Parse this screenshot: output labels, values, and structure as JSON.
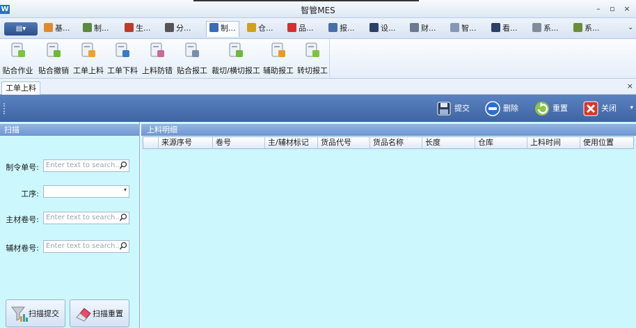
{
  "window": {
    "title": "智管MES",
    "app_icon": "W",
    "minimize": "–",
    "maximize": "▫",
    "close": "×"
  },
  "menu": {
    "app_button": "▤▾",
    "tabs": [
      {
        "label": "基...",
        "icon": "basic-data-icon",
        "color": "#e28a2b"
      },
      {
        "label": "制...",
        "icon": "chart-icon",
        "color": "#5a8a3a"
      },
      {
        "label": "生...",
        "icon": "production-icon",
        "color": "#c0392b"
      },
      {
        "label": "分...",
        "icon": "scissors-icon",
        "color": "#555555"
      },
      {
        "label": "制...",
        "icon": "magnifier-icon",
        "color": "#3b6cb7"
      },
      {
        "label": "仓...",
        "icon": "warehouse-icon",
        "color": "#d4a017"
      },
      {
        "label": "品...",
        "icon": "diamond-icon",
        "color": "#d63031"
      },
      {
        "label": "报...",
        "icon": "report-icon",
        "color": "#4a6fa5"
      },
      {
        "label": "设...",
        "icon": "device-icon",
        "color": "#2d3f66"
      },
      {
        "label": "财...",
        "icon": "finance-icon",
        "color": "#6b7a8f"
      },
      {
        "label": "智...",
        "icon": "smart-icon",
        "color": "#8597b5"
      },
      {
        "label": "看...",
        "icon": "board-icon",
        "color": "#2d3f66"
      },
      {
        "label": "系...",
        "icon": "gear-icon",
        "color": "#7f8c9b"
      },
      {
        "label": "系...",
        "icon": "system-icon",
        "color": "#6a8f3a"
      }
    ],
    "more": "⌄",
    "active_tab_index": 4
  },
  "ribbon": {
    "buttons": [
      {
        "label": "贴合作业",
        "icon": "laminate-work-icon"
      },
      {
        "label": "贴合撤销",
        "icon": "laminate-undo-icon"
      },
      {
        "label": "工单上料",
        "icon": "order-feed-icon"
      },
      {
        "label": "工单下料",
        "icon": "order-unload-icon"
      },
      {
        "label": "上料防错",
        "icon": "feed-errorproof-icon"
      },
      {
        "label": "贴合报工",
        "icon": "laminate-report-icon"
      },
      {
        "label": "裁切/横切报工",
        "icon": "cut-report-icon"
      },
      {
        "label": "辅助报工",
        "icon": "aux-report-icon"
      },
      {
        "label": "转切报工",
        "icon": "rotary-report-icon"
      }
    ]
  },
  "doc_tab": {
    "label": "工单上料",
    "close": "×"
  },
  "toolbar": {
    "submit": "提交",
    "delete": "删除",
    "reset": "重置",
    "close": "关闭",
    "more": "▾"
  },
  "scan_panel": {
    "title": "扫描",
    "fields": {
      "order_no_label": "制令单号:",
      "order_no_placeholder": "Enter text to search...",
      "process_label": "工序:",
      "process_value": "",
      "main_roll_label": "主材卷号:",
      "main_roll_placeholder": "Enter text to search...",
      "aux_roll_label": "辅材卷号:",
      "aux_roll_placeholder": "Enter text to search..."
    },
    "scan_submit": "扫描提交",
    "scan_reset": "扫描重置"
  },
  "detail": {
    "title": "上料明细",
    "columns": [
      "来源序号",
      "卷号",
      "主/辅材标记",
      "货品代号",
      "货品名称",
      "长度",
      "仓库",
      "上料时间",
      "使用位置"
    ],
    "rows": []
  },
  "colors": {
    "toolbar_bg": "#4a70ad",
    "panel_bg": "#ccf7fd",
    "header_bg": "#7fa3d9"
  }
}
